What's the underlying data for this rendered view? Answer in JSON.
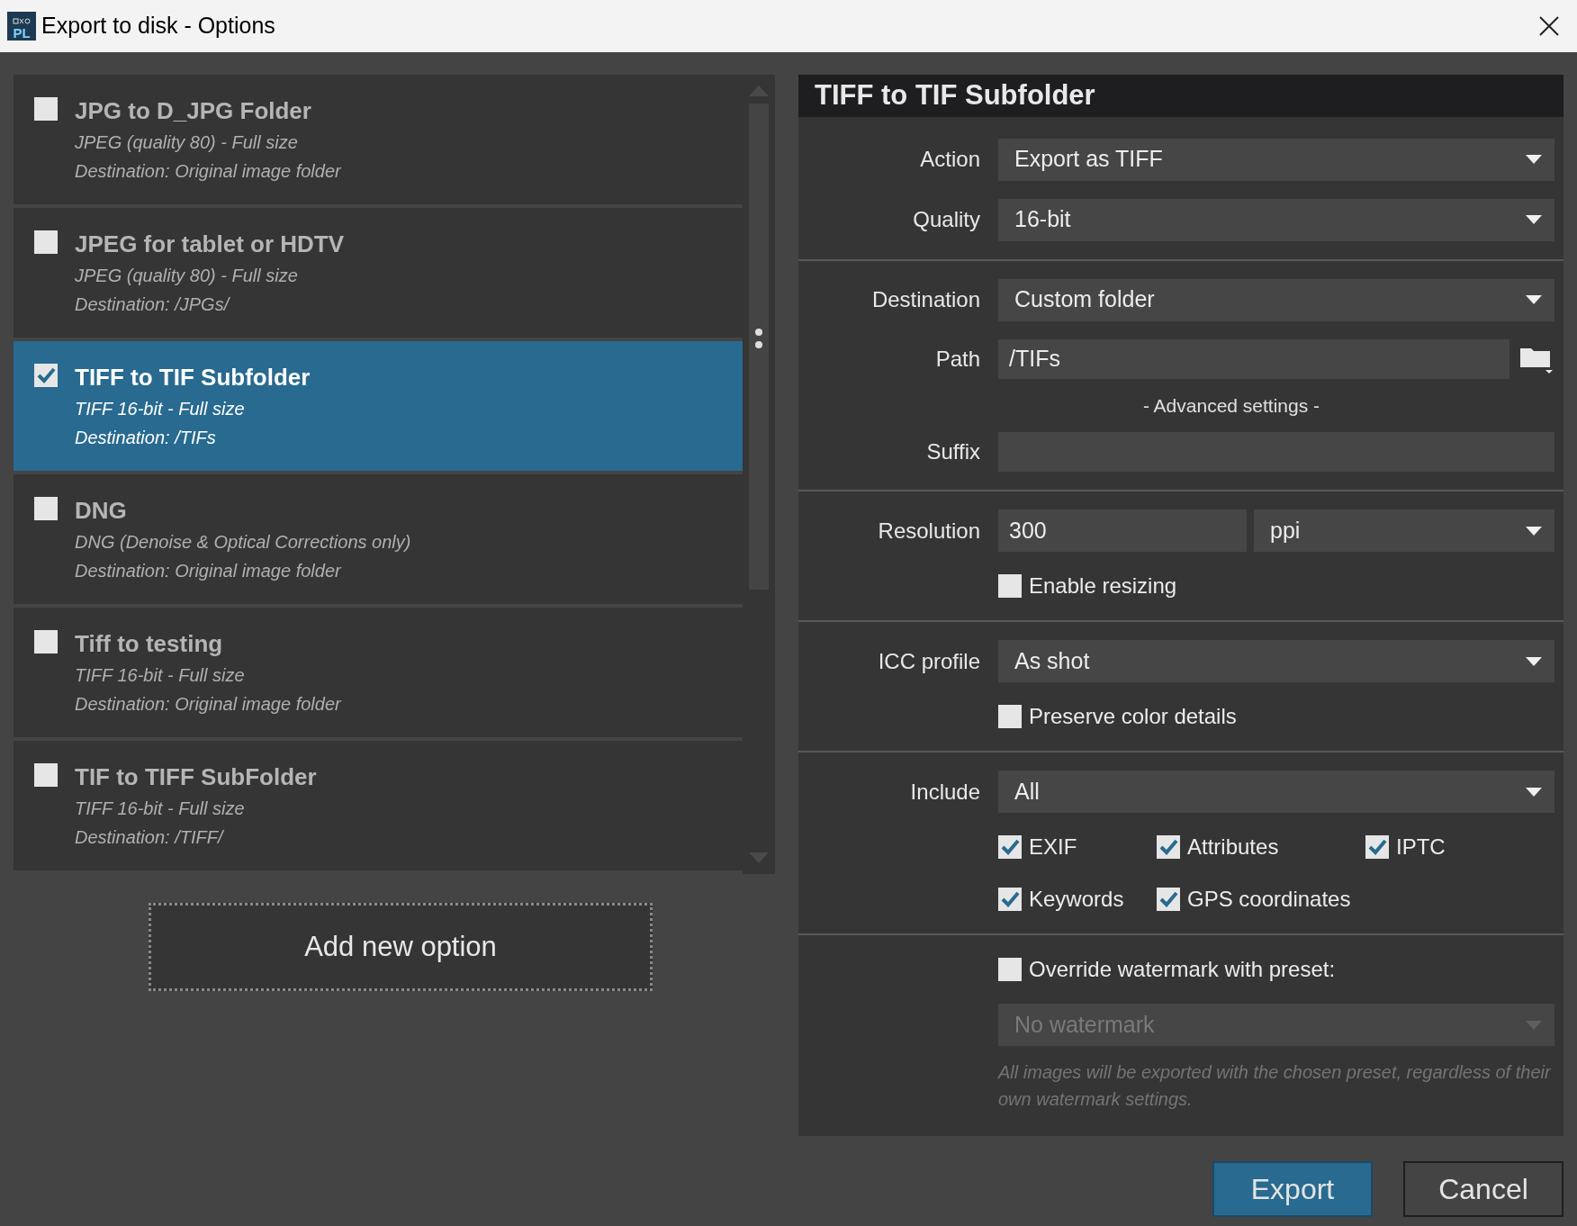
{
  "window": {
    "title": "Export to disk - Options",
    "logo": "PL"
  },
  "presets": [
    {
      "title": "JPG to D_JPG Folder",
      "format": "JPEG (quality 80) - Full size",
      "destination": "Destination: Original image folder",
      "checked": false,
      "selected": false
    },
    {
      "title": "JPEG for tablet or HDTV",
      "format": "JPEG (quality 80) - Full size",
      "destination": "Destination: /JPGs/",
      "checked": false,
      "selected": false
    },
    {
      "title": "TIFF to TIF Subfolder",
      "format": "TIFF 16-bit - Full size",
      "destination": "Destination: /TIFs",
      "checked": true,
      "selected": true
    },
    {
      "title": "DNG",
      "format": "DNG (Denoise & Optical Corrections only)",
      "destination": "Destination: Original image folder",
      "checked": false,
      "selected": false
    },
    {
      "title": "Tiff to testing",
      "format": "TIFF 16-bit - Full size",
      "destination": "Destination: Original image folder",
      "checked": false,
      "selected": false
    },
    {
      "title": "TIF to TIFF SubFolder",
      "format": "TIFF 16-bit - Full size",
      "destination": "Destination: /TIFF/",
      "checked": false,
      "selected": false
    }
  ],
  "add_button": "Add new option",
  "details": {
    "title": "TIFF to TIF Subfolder",
    "sections": [
      {
        "rows": [
          {
            "kind": "dropdown",
            "label": "Action",
            "value": "Export as TIFF",
            "disabled": false
          },
          {
            "kind": "dropdown",
            "label": "Quality",
            "value": "16-bit",
            "disabled": false
          }
        ]
      },
      {
        "rows": [
          {
            "kind": "dropdown",
            "label": "Destination",
            "value": "Custom folder",
            "disabled": false
          },
          {
            "kind": "path",
            "label": "Path",
            "value": "/TIFs"
          },
          {
            "kind": "caption",
            "text": "- Advanced settings -"
          },
          {
            "kind": "text",
            "label": "Suffix"
          }
        ]
      },
      {
        "rows": [
          {
            "kind": "resolution",
            "label": "Resolution",
            "value": "300",
            "unit": "ppi"
          },
          {
            "kind": "checkbox",
            "label": "Enable resizing",
            "checked": false
          }
        ]
      },
      {
        "rows": [
          {
            "kind": "dropdown",
            "label": "ICC profile",
            "value": "As shot",
            "disabled": false
          },
          {
            "kind": "checkbox",
            "label": "Preserve color details",
            "checked": false
          }
        ]
      },
      {
        "rows": [
          {
            "kind": "dropdown",
            "label": "Include",
            "value": "All",
            "disabled": false
          },
          {
            "kind": "checkgrid",
            "items": [
              {
                "label": "EXIF",
                "checked": true
              },
              {
                "label": "Attributes",
                "checked": true
              },
              {
                "label": "IPTC",
                "checked": true
              },
              {
                "label": "Keywords",
                "checked": true
              },
              {
                "label": "GPS coordinates",
                "checked": true
              }
            ]
          }
        ]
      },
      {
        "rows": [
          {
            "kind": "checkbox",
            "label": "Override watermark with preset:",
            "checked": false
          },
          {
            "kind": "dropdown",
            "value": "No watermark",
            "disabled": true
          },
          {
            "kind": "hint",
            "text": "All images will be exported with the chosen preset, regardless of their own watermark settings."
          }
        ]
      }
    ]
  },
  "buttons": [
    {
      "label": "Export",
      "primary": true
    },
    {
      "label": "Cancel",
      "primary": false
    }
  ]
}
